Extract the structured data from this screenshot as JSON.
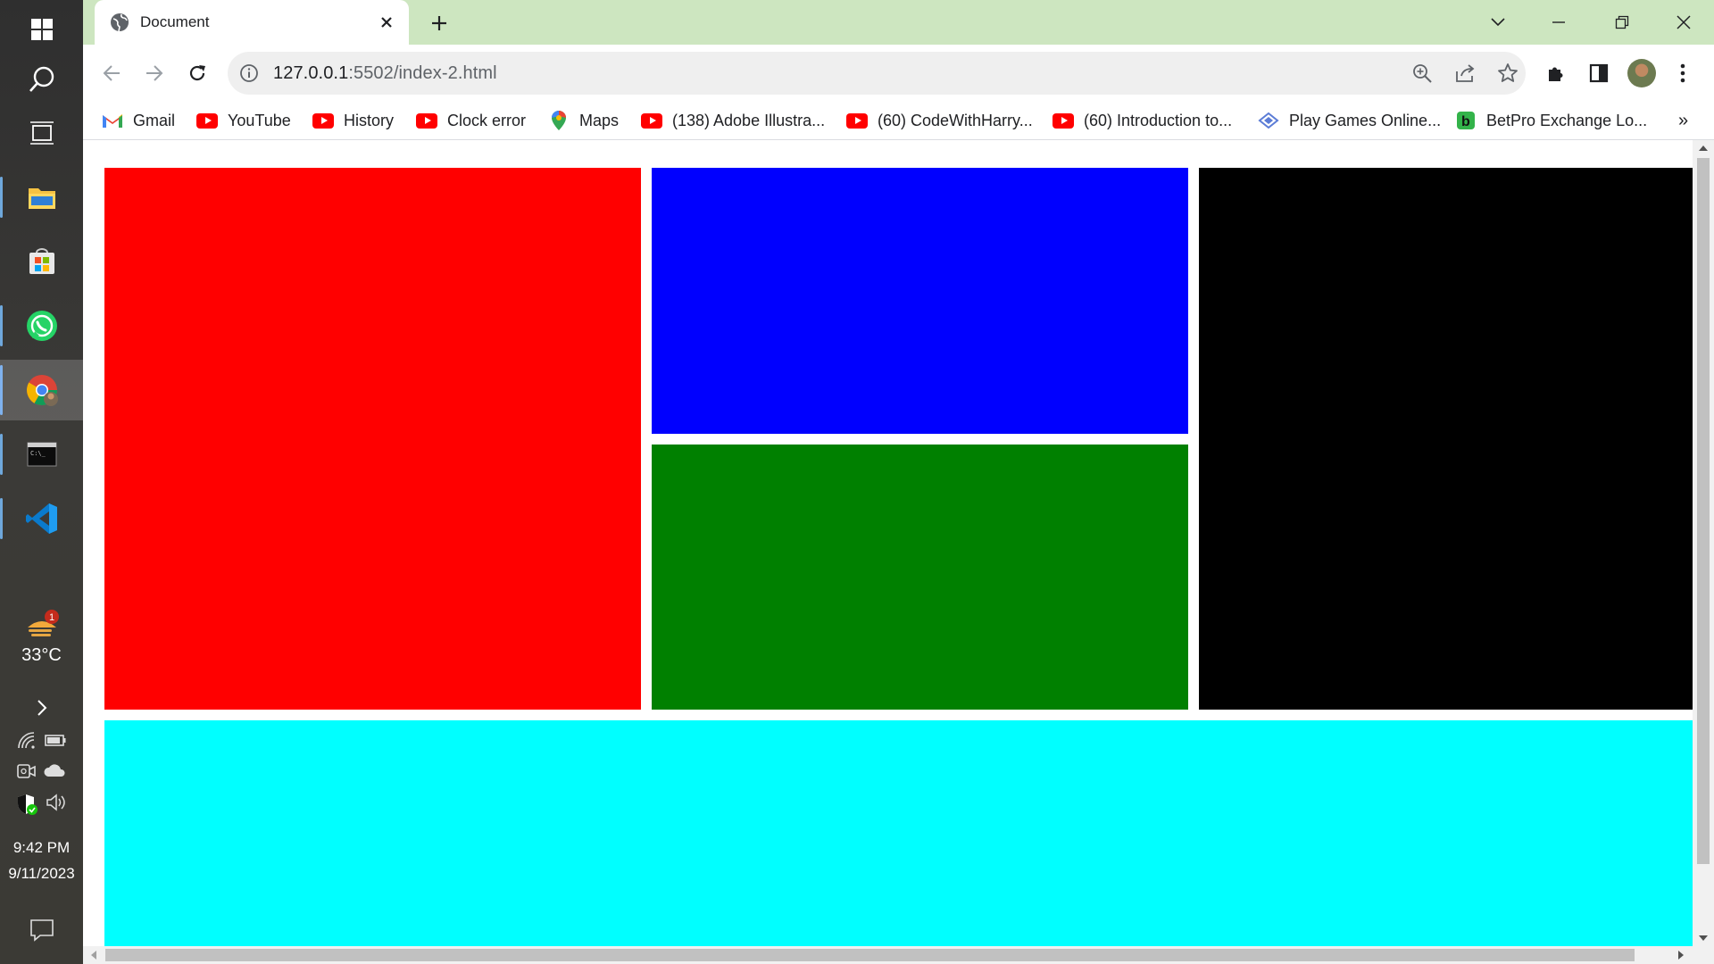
{
  "taskbar": {
    "apps": [
      "windows-start",
      "search",
      "task-view",
      "file-explorer",
      "microsoft-store",
      "whatsapp",
      "chrome",
      "terminal",
      "vscode"
    ],
    "weather": {
      "temp": "33°C",
      "badge": "1"
    },
    "clock": {
      "time": "9:42 PM",
      "date": "9/11/2023"
    }
  },
  "browser": {
    "tab": {
      "title": "Document"
    },
    "address": {
      "host": "127.0.0.1",
      "path": ":5502/index-2.html"
    },
    "bookmarks": [
      {
        "label": "Gmail",
        "icon": "gmail-icon"
      },
      {
        "label": "YouTube",
        "icon": "youtube-icon"
      },
      {
        "label": "History",
        "icon": "youtube-icon"
      },
      {
        "label": "Clock error",
        "icon": "youtube-icon"
      },
      {
        "label": "Maps",
        "icon": "maps-icon"
      },
      {
        "label": "(138) Adobe Illustra...",
        "icon": "youtube-icon"
      },
      {
        "label": "(60) CodeWithHarry...",
        "icon": "youtube-icon"
      },
      {
        "label": "(60) Introduction to...",
        "icon": "youtube-icon"
      },
      {
        "label": "Play Games Online...",
        "icon": "games-icon"
      },
      {
        "label": "BetPro Exchange Lo...",
        "icon": "betpro-icon"
      }
    ],
    "overflow": "»"
  },
  "page": {
    "boxes": [
      {
        "name": "red-box",
        "color": "#ff0000"
      },
      {
        "name": "blue-box",
        "color": "#0000ff"
      },
      {
        "name": "green-box",
        "color": "#008000"
      },
      {
        "name": "black-box",
        "color": "#000000"
      },
      {
        "name": "cyan-box",
        "color": "#00ffff"
      }
    ]
  }
}
